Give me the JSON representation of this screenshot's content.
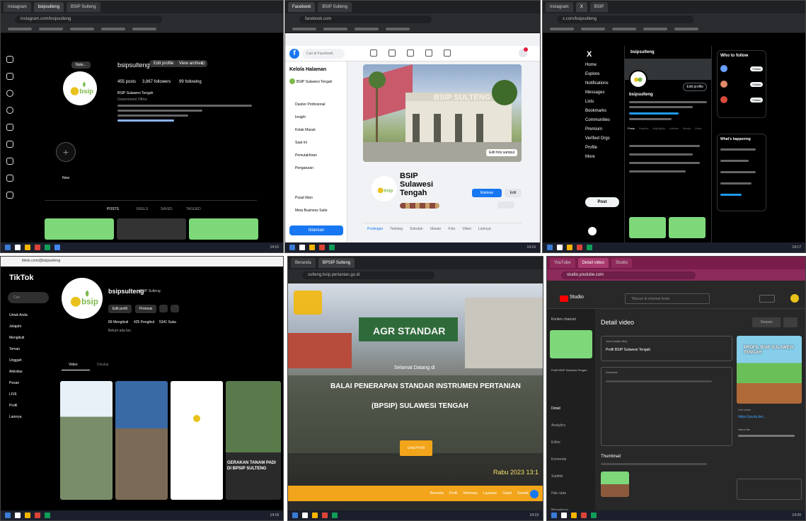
{
  "p1": {
    "url": "instagram.com/bsipsulteng",
    "username": "bsipsulteng",
    "edit_profile": "Edit profile",
    "view_archive": "View archive",
    "stats": [
      "455 posts",
      "3,867 followers",
      "99 following"
    ],
    "bio_name": "BSIP Sulawesi Tengah",
    "bio_category": "Government Office",
    "highlight_label": "New",
    "tabs": [
      "POSTS",
      "REELS",
      "SAVED",
      "TAGGED"
    ]
  },
  "p2": {
    "url": "facebook.com",
    "search_placeholder": "Cari di Facebook",
    "side_title": "Kelola Halaman",
    "side_page": "BSIP Sulawesi Tengah",
    "side_items": [
      "Dasbor Profesional",
      "Insight",
      "Kotak Masuk",
      "Saat Ini",
      "Pemutakhiran",
      "Pengaturan",
      "Pusat Iklan",
      "Meta Business Suite"
    ],
    "promote": "Iklankan",
    "cover_sign": "BSIP SULTENG",
    "page_name": "BSIP Sulawesi Tengah",
    "edit_cover": "Edit foto sampul",
    "btn_iklan": "Iklankan",
    "btn_edit": "Edit",
    "tabs": [
      "Postingan",
      "Tentang",
      "Sebutan",
      "Ulasan",
      "Foto",
      "Video",
      "Lainnya"
    ]
  },
  "p3": {
    "url": "x.com/bsipsulteng",
    "nav": [
      "Home",
      "Explore",
      "Notifications",
      "Messages",
      "Lists",
      "Bookmarks",
      "Communities",
      "Premium",
      "Verified Orgs",
      "Profile",
      "More"
    ],
    "post_button": "Post",
    "profile_name": "bsipsulteng",
    "edit_profile": "Edit profile",
    "who_to_follow": "Who to follow",
    "follow_label": "Follow",
    "whats_happening": "What's happening",
    "tabs": [
      "Posts",
      "Replies",
      "Highlights",
      "Articles",
      "Media",
      "Likes"
    ]
  },
  "p4": {
    "url": "tiktok.com/@bsipsulteng",
    "brand": "TikTok",
    "search": "Cari",
    "nav": [
      "Untuk Anda",
      "Jelajahi",
      "Mengikuti",
      "Teman",
      "Unggah",
      "Aktivitas",
      "Pesan",
      "LIVE",
      "Profil",
      "Lainnya"
    ],
    "username": "bsipsulteng",
    "display_name": "BSIP Sulteng",
    "edit": "Edit profil",
    "promote": "Promosi",
    "stats": [
      "89 Mengikuti",
      "425 Pengikut",
      "5341 Suka"
    ],
    "bio": "Belum ada bio",
    "tabs": [
      "Video",
      "Disukai"
    ],
    "captions": [
      "GERAKAN TANAM PADI DI BPSIP SULTENG"
    ]
  },
  "p5": {
    "url": "sulteng.bsip.pertanian.go.id",
    "sign": "AGR STANDAR",
    "welcome": "Selamat Datang di",
    "title_line1": "BALAI PENERAPAN STANDAR INSTRUMEN PERTANIAN",
    "title_line2": "(BPSIP) SULAWESI TENGAH",
    "cta": "Lihat Profil",
    "stamp": "Rabu 2023 13:1",
    "footer_links": [
      "Beranda",
      "Profil",
      "Informasi",
      "Layanan",
      "Galeri",
      "Kontak"
    ]
  },
  "p6": {
    "url": "studio.youtube.com",
    "brand": "Studio",
    "search": "Telusuri di channel Anda",
    "channel_label": "Konten channel",
    "video_title": "Profil BSIP Sulawesi Tengah",
    "heading": "Detail video",
    "field_title": "Judul (wajib diisi)",
    "field_desc": "Deskripsi",
    "thumbnail": "Thumbnail",
    "nav": [
      "Detail",
      "Analytics",
      "Editor",
      "Komentar",
      "Subtitle",
      "Hak cipta",
      "Monetisasi"
    ],
    "video_link_label": "Link video",
    "video_link": "https://youtu.be/...",
    "filename_label": "Nama file",
    "thumb_title": "PROFIL BSIP SULAWESI TENGAH",
    "save": "Simpan"
  },
  "colors": {
    "bsip_green": "#7bb84a",
    "bsip_yellow": "#e8c21a",
    "facebook_blue": "#1877f2",
    "youtube_red": "#ff0000",
    "website_orange": "#f2a51a"
  }
}
